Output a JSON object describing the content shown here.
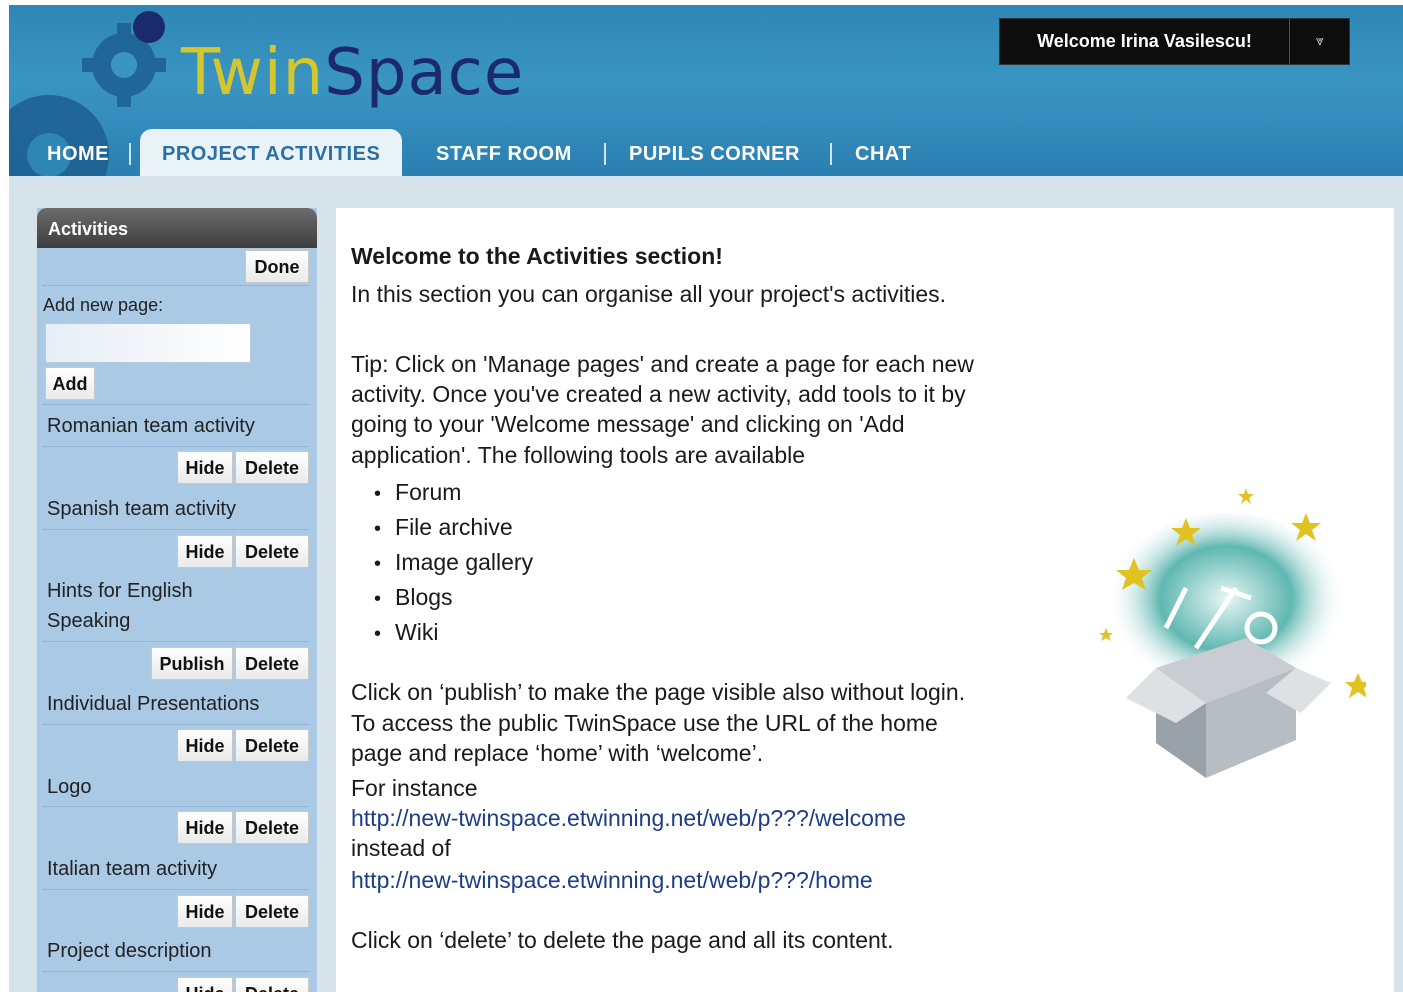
{
  "header": {
    "logo_twin": "Twin",
    "logo_space": "Space",
    "welcome": "Welcome Irina Vasilescu!",
    "welcome_menu_glyph": "⩔"
  },
  "nav": {
    "home": "HOME",
    "project_activities": "PROJECT ACTIVITIES",
    "staff_room": "STAFF ROOM",
    "pupils_corner": "PUPILS CORNER",
    "chat": "CHAT"
  },
  "sidebar": {
    "title": "Activities",
    "done_label": "Done",
    "add_new_page_label": "Add new page:",
    "add_label": "Add",
    "pages": [
      {
        "title": "Romanian team activity",
        "action": "Hide",
        "delete": "Delete"
      },
      {
        "title": "Spanish team activity",
        "action": "Hide",
        "delete": "Delete"
      },
      {
        "title_line1": "Hints for English",
        "title_line2": "Speaking",
        "action": "Publish",
        "delete": "Delete"
      },
      {
        "title": "Individual Presentations",
        "action": "Hide",
        "delete": "Delete"
      },
      {
        "title": "Logo",
        "action": "Hide",
        "delete": "Delete"
      },
      {
        "title": "Italian team activity",
        "action": "Hide",
        "delete": "Delete"
      },
      {
        "title": "Project description",
        "action": "Hide",
        "delete": "Delete"
      }
    ]
  },
  "main": {
    "welcome_title": "Welcome to the Activities section!",
    "intro": "In this section you can organise all your project's activities.",
    "tip_line1": "Tip: Click on 'Manage pages' and create a page for each new",
    "tip_line2": "activity. Once you've created a new activity, add tools to it by",
    "tip_line3": "going to your 'Welcome message' and clicking on 'Add",
    "tip_line4": "application'. The following tools are available",
    "tools": [
      "Forum",
      "File archive",
      "Image gallery",
      "Blogs",
      "Wiki"
    ],
    "publish_line1": "Click on ‘publish’ to make the page visible also without login.",
    "publish_line2": "To access the public TwinSpace use the URL of the home",
    "publish_line3": "page and replace ‘home’ with ‘welcome’.",
    "for_instance": "For instance",
    "url_welcome": "http://new-twinspace.etwinning.net/web/p???/welcome",
    "instead_of": "instead of",
    "url_home": "http://new-twinspace.etwinning.net/web/p???/home",
    "delete_note": "Click on ‘delete’ to delete the page and all its content."
  },
  "colors": {
    "header_blue": "#3a95c3",
    "logo_twin": "#d4c62c",
    "logo_space": "#1b2a6b",
    "sidebar_bg": "#a9c9e4",
    "link": "#1d3d87"
  }
}
